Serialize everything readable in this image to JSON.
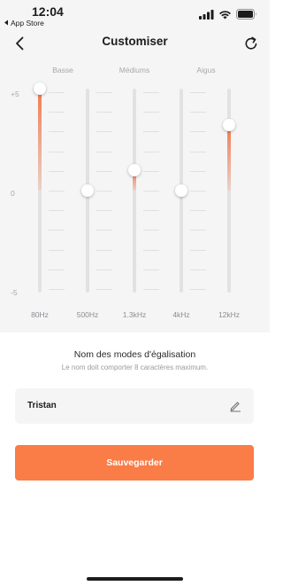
{
  "status_bar": {
    "time": "12:04",
    "back_app_label": "App Store"
  },
  "header": {
    "title": "Customiser",
    "back_icon": "chevron-left-icon",
    "reset_icon": "refresh-icon"
  },
  "equalizer": {
    "band_groups": [
      "Basse",
      "Médiums",
      "Aigus"
    ],
    "db_scale": [
      "+5",
      "0",
      "-5"
    ],
    "db_range": [
      -5,
      5
    ],
    "accent_color": "#f07b4f",
    "bands": [
      {
        "freq": "80Hz",
        "gain": 5
      },
      {
        "freq": "500Hz",
        "gain": 0
      },
      {
        "freq": "1.3kHz",
        "gain": 1
      },
      {
        "freq": "4kHz",
        "gain": 0
      },
      {
        "freq": "12kHz",
        "gain": 3.2
      }
    ]
  },
  "mode_name": {
    "title": "Nom des modes d'égalisation",
    "hint": "Le nom doit comporter 8 caractères maximum.",
    "value": "Tristan",
    "edit_icon": "pencil-icon"
  },
  "save_button": {
    "label": "Sauvegarder",
    "color": "#fa7c47"
  }
}
